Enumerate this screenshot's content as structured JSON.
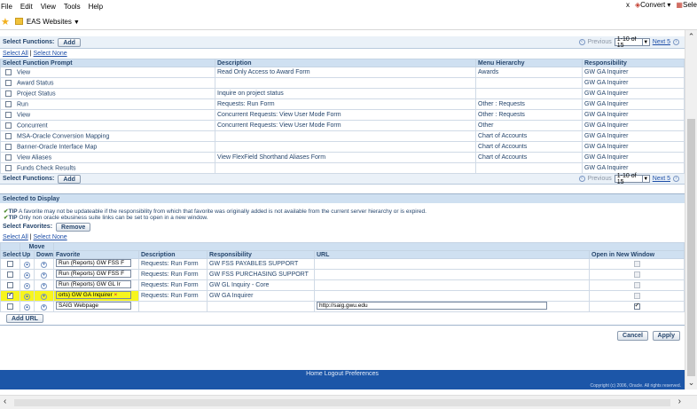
{
  "browser": {
    "menu": [
      "File",
      "Edit",
      "View",
      "Tools",
      "Help"
    ],
    "right_close": "x",
    "convert_label": "Convert",
    "select_label": "Sele",
    "favorite_folder": "EAS Websites"
  },
  "functions": {
    "header_label": "Select Functions:",
    "add_button": "Add",
    "select_all": "Select All",
    "select_none": "Select None",
    "previous": "Previous",
    "range": "1-10 of 15",
    "next": "Next 5",
    "columns": [
      "Select Function Prompt",
      "Description",
      "Menu Hierarchy",
      "Responsibility"
    ],
    "rows": [
      {
        "prompt": "View",
        "description": "Read Only Access to Award Form",
        "menu": "Awards",
        "resp": "GW GA Inquirer"
      },
      {
        "prompt": "Award Status",
        "description": "",
        "menu": "",
        "resp": "GW GA Inquirer"
      },
      {
        "prompt": "Project Status",
        "description": "Inquire on project status",
        "menu": "",
        "resp": "GW GA Inquirer"
      },
      {
        "prompt": "Run",
        "description": "Requests: Run Form",
        "menu": "Other : Requests",
        "resp": "GW GA Inquirer"
      },
      {
        "prompt": "View",
        "description": "Concurrent Requests: View User Mode Form",
        "menu": "Other : Requests",
        "resp": "GW GA Inquirer"
      },
      {
        "prompt": "Concurrent",
        "description": "Concurrent Requests: View User Mode Form",
        "menu": "Other",
        "resp": "GW GA Inquirer"
      },
      {
        "prompt": "MSA-Oracle Conversion Mapping",
        "description": "",
        "menu": "Chart of Accounts",
        "resp": "GW GA Inquirer"
      },
      {
        "prompt": "Banner-Oracle Interface Map",
        "description": "",
        "menu": "Chart of Accounts",
        "resp": "GW GA Inquirer"
      },
      {
        "prompt": "View Aliases",
        "description": "View FlexField Shorthand Aliases Form",
        "menu": "Chart of Accounts",
        "resp": "GW GA Inquirer"
      },
      {
        "prompt": "Funds Check Results",
        "description": "",
        "menu": "",
        "resp": "GW GA Inquirer"
      }
    ]
  },
  "selected": {
    "title": "Selected to Display",
    "tip1": "A favorite may not be updateable if the responsibility from which that favorite was originally added is not available from the current server hierarchy or is expired.",
    "tip2": "Only non oracle ebusiness suite links can be set to open in a new window.",
    "tip_label": "TIP",
    "favorites_label": "Select Favorites:",
    "remove_button": "Remove",
    "select_all": "Select All",
    "select_none": "Select None",
    "move_label": "Move",
    "columns": [
      "Select",
      "Up",
      "Down",
      "Favorite",
      "Description",
      "Responsibility",
      "URL",
      "Open in New Window"
    ],
    "rows": [
      {
        "favorite": "Run (Reports) GW FSS F",
        "description": "Requests: Run Form",
        "resp": "GW FSS PAYABLES SUPPORT",
        "url": "",
        "checked": false,
        "newwin": false,
        "newwin_enabled": false
      },
      {
        "favorite": "Run (Reports) GW FSS F",
        "description": "Requests: Run Form",
        "resp": "GW FSS PURCHASING SUPPORT",
        "url": "",
        "checked": false,
        "newwin": false,
        "newwin_enabled": false
      },
      {
        "favorite": "Run (Reports) GW GL Ir",
        "description": "Requests: Run Form",
        "resp": "GW GL Inquiry - Core",
        "url": "",
        "checked": false,
        "newwin": false,
        "newwin_enabled": false
      },
      {
        "favorite": "orts) GW GA Inquirer",
        "description": "Requests: Run Form",
        "resp": "GW GA Inquirer",
        "url": "",
        "checked": true,
        "newwin": false,
        "newwin_enabled": false
      },
      {
        "favorite": "SAIG Webpage",
        "description": "",
        "resp": "",
        "url": "http://saig.gwu.edu",
        "checked": false,
        "newwin": true,
        "newwin_enabled": true
      }
    ],
    "add_url_button": "Add URL"
  },
  "actions": {
    "cancel": "Cancel",
    "apply": "Apply"
  },
  "footer": {
    "links": "Home  Logout  Preferences",
    "copyright": "Copyright (c) 2006, Oracle. All rights reserved."
  }
}
